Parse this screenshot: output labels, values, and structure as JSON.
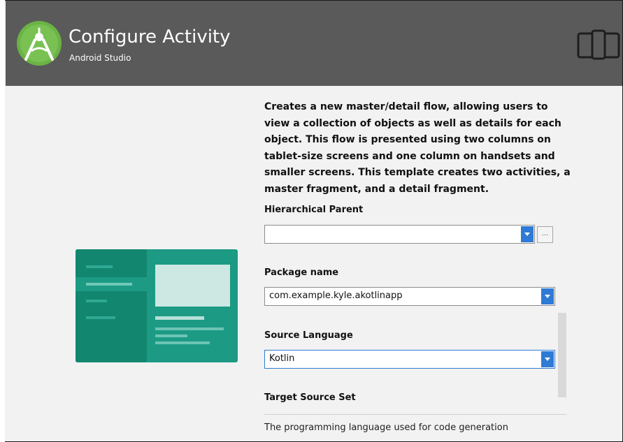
{
  "header": {
    "title": "Configure Activity",
    "subtitle": "Android Studio",
    "logo_icon": "android-studio-logo-icon",
    "device_icon": "phone-tablet-icon"
  },
  "description": "Creates a new master/detail flow, allowing users to view a collection of objects as well as details for each object. This flow is presented using two columns on tablet-size screens and one column on handsets and smaller screens. This template creates two activities, a master fragment, and a detail fragment.",
  "form": {
    "hierarchical_parent": {
      "label": "Hierarchical Parent",
      "value": "",
      "browse_label": "..."
    },
    "package_name": {
      "label": "Package name",
      "value": "com.example.kyle.akotlinapp"
    },
    "source_language": {
      "label": "Source Language",
      "value": "Kotlin"
    },
    "target_source_set": {
      "label": "Target Source Set"
    }
  },
  "help_text": "The programming language used for code generation",
  "colors": {
    "header_bg": "#5a5a5a",
    "accent": "#2e7ad4",
    "illustration_primary": "#1c9a84",
    "illustration_dark": "#13866f"
  }
}
